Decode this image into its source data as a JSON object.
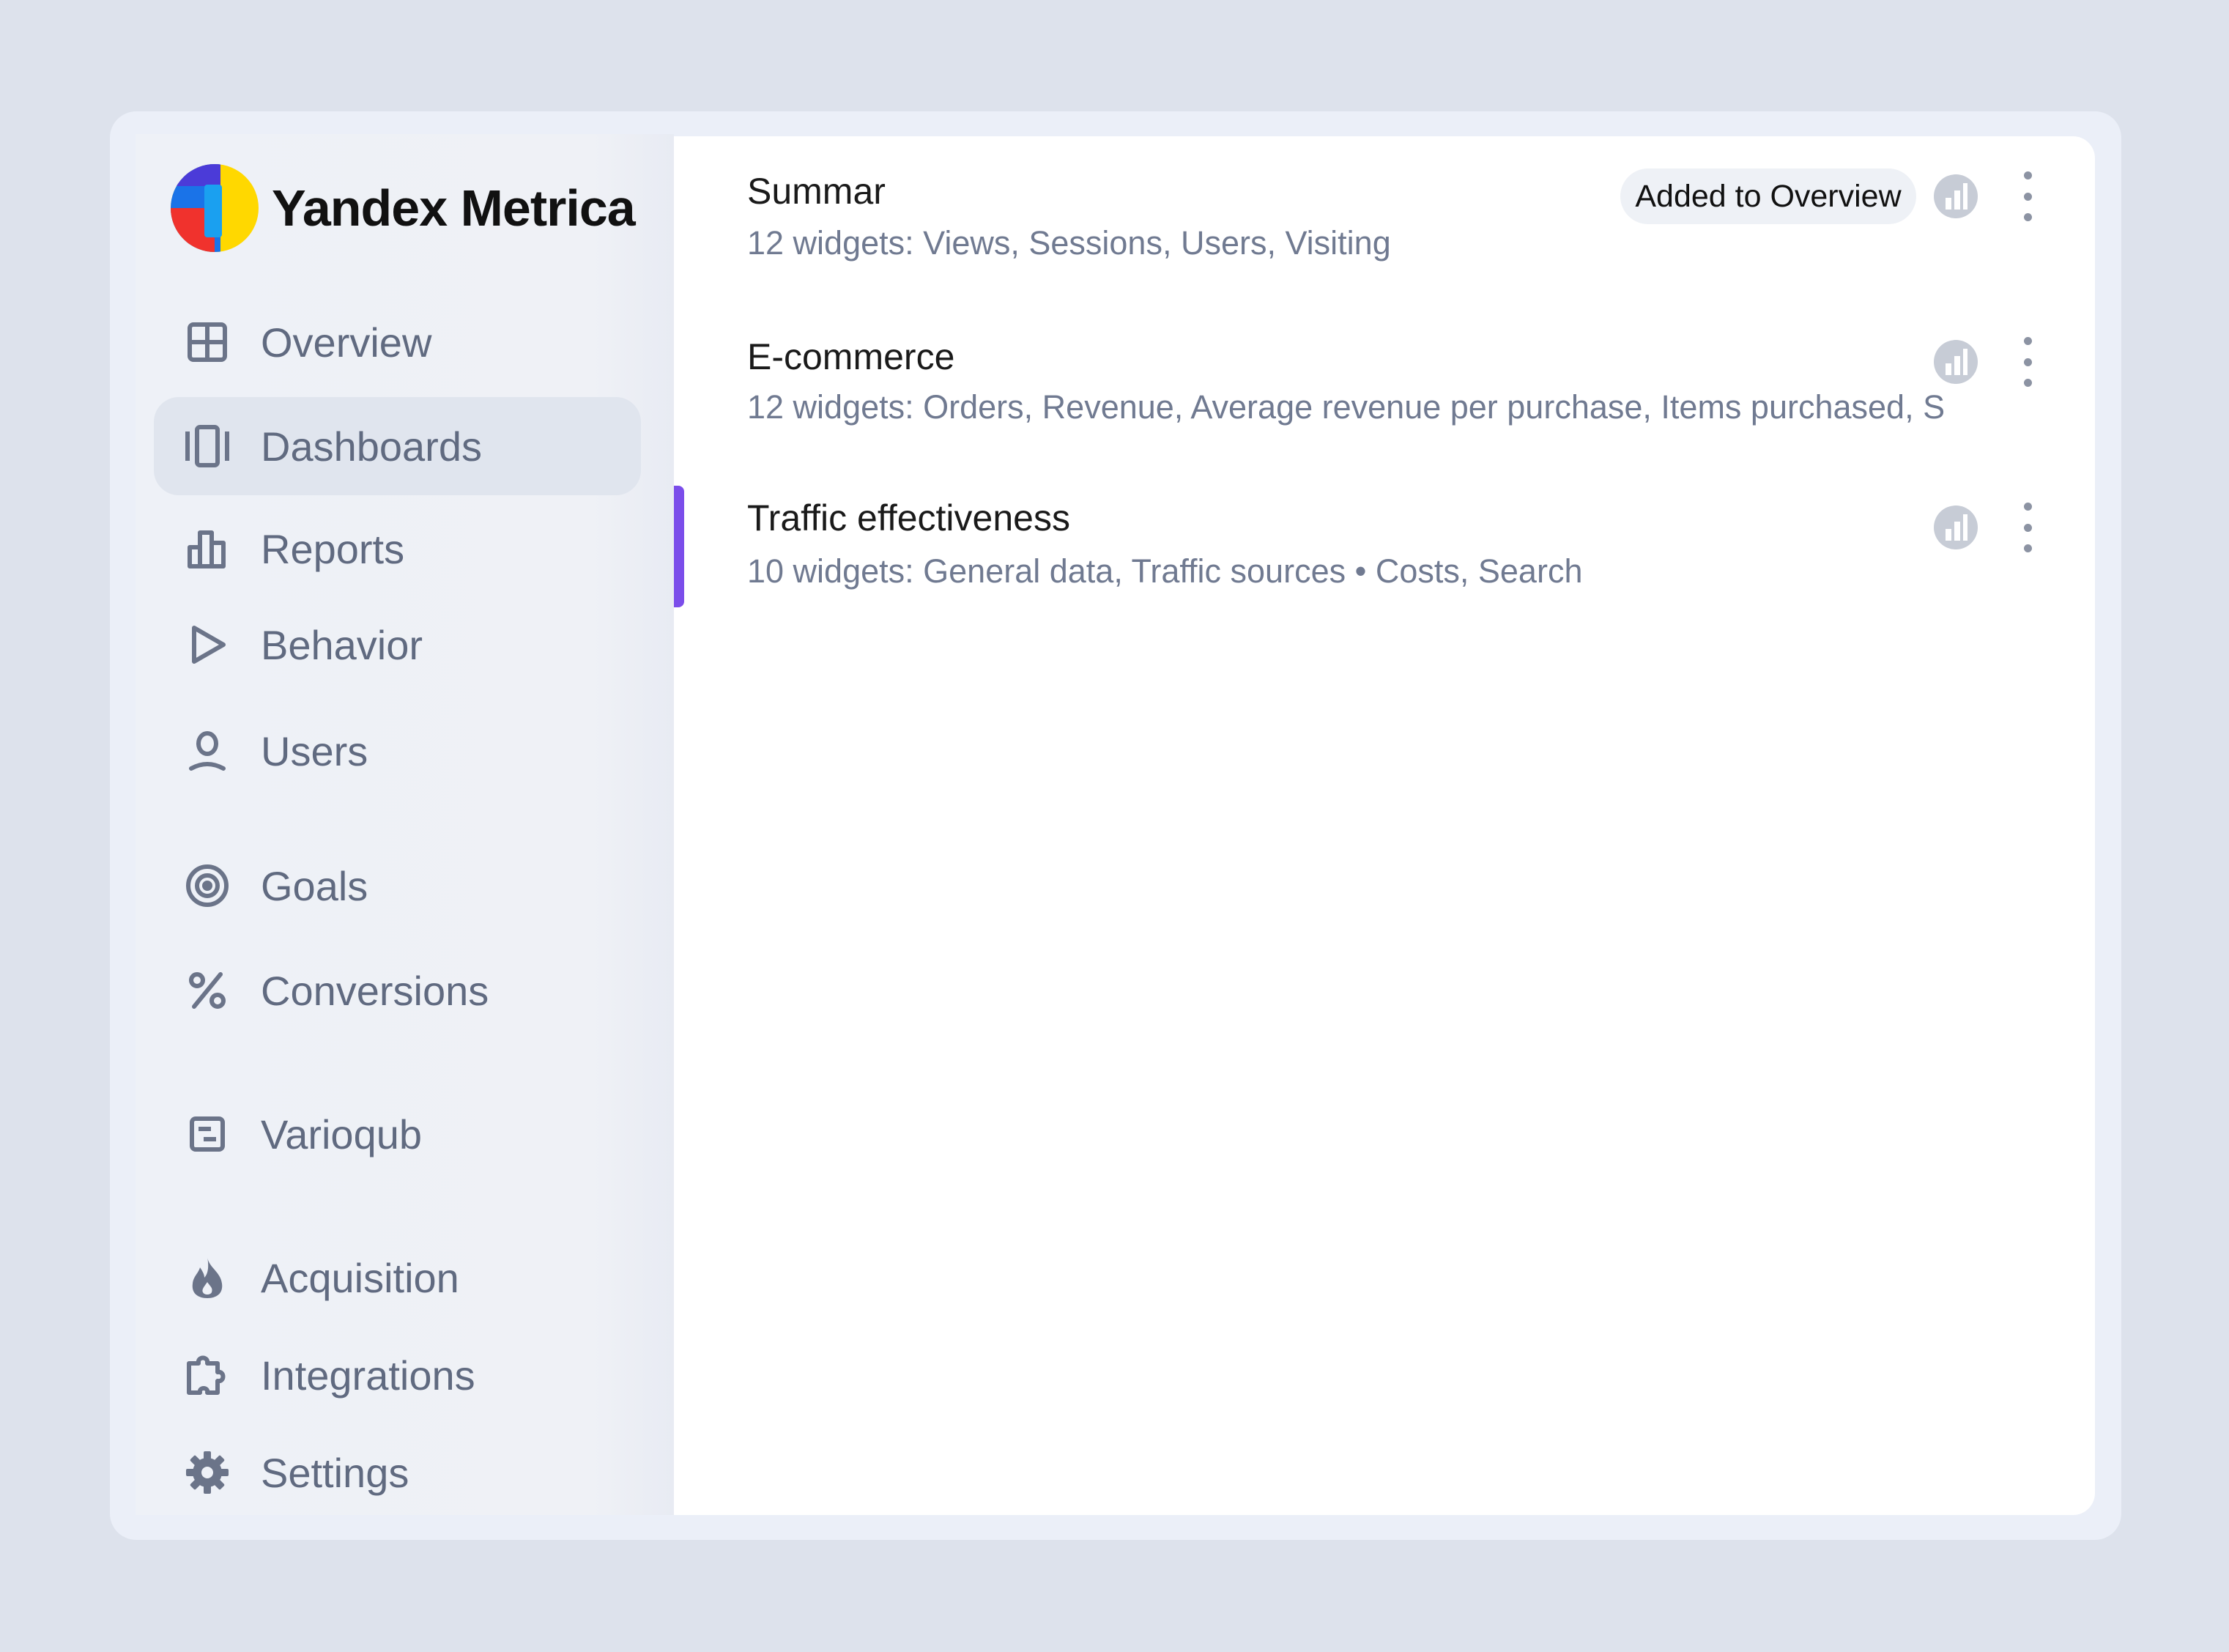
{
  "app": {
    "name": "Yandex Metrica",
    "brand_colors": [
      "#f0322d",
      "#1a73e8",
      "#ffd800"
    ]
  },
  "sidebar": {
    "items": [
      {
        "label": "Overview",
        "icon": "grid-icon",
        "active": false
      },
      {
        "label": "Dashboards",
        "icon": "dashboards-icon",
        "active": true
      },
      {
        "label": "Reports",
        "icon": "bar-chart-icon",
        "active": false
      },
      {
        "label": "Behavior",
        "icon": "play-icon",
        "active": false
      },
      {
        "label": "Users",
        "icon": "user-icon",
        "active": false
      },
      {
        "label": "Goals",
        "icon": "target-icon",
        "active": false
      },
      {
        "label": "Conversions",
        "icon": "percent-icon",
        "active": false
      },
      {
        "label": "Varioqub",
        "icon": "varioqub-icon",
        "active": false
      },
      {
        "label": "Acquisition",
        "icon": "flame-icon",
        "active": false
      },
      {
        "label": "Integrations",
        "icon": "puzzle-icon",
        "active": false
      },
      {
        "label": "Settings",
        "icon": "gear-icon",
        "active": false
      }
    ]
  },
  "dashboards": [
    {
      "title": "Summar",
      "description": "12 widgets: Views, Sessions, Users, Visiting",
      "badge": "Added to Overview",
      "selected": false
    },
    {
      "title": "E-commerce",
      "description": "12 widgets: Orders, Revenue, Average revenue per purchase, Items purchased, S",
      "badge": "",
      "selected": false
    },
    {
      "title": "Traffic effectiveness",
      "description": "10 widgets: General data, Traffic sources • Costs, Search",
      "badge": "",
      "selected": true
    }
  ],
  "colors": {
    "accent": "#7b4dea",
    "sidebar_text": "#606a80",
    "secondary_text": "#707a91"
  }
}
